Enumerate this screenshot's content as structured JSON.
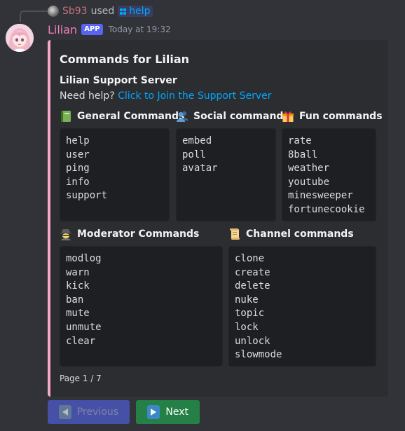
{
  "reply": {
    "username": "Sb93",
    "used_text": "used",
    "command": "help"
  },
  "message": {
    "author": "Lilian",
    "badge": "APP",
    "timestamp": "Today at 19:32"
  },
  "embed": {
    "accent_color": "#f7a8c8",
    "title": "Commands for Lilian",
    "subtitle": "Lilian Support Server",
    "help_prefix": "Need help?",
    "help_link": "Click to Join the Support Server",
    "fields": [
      {
        "icon": "green-book-icon",
        "name": "General Commands",
        "items": [
          "help",
          "user",
          "ping",
          "info",
          "support"
        ]
      },
      {
        "icon": "busts-in-silhouette-icon",
        "name": "Social commands",
        "items": [
          "embed",
          "poll",
          "avatar"
        ]
      },
      {
        "icon": "wrapped-gift-icon",
        "name": "Fun commands",
        "items": [
          "rate",
          "8ball",
          "weather",
          "youtube",
          "minesweeper",
          "fortunecookie"
        ]
      },
      {
        "icon": "detective-icon",
        "name": "Moderator Commands",
        "items": [
          "modlog",
          "warn",
          "kick",
          "ban",
          "mute",
          "unmute",
          "clear"
        ]
      },
      {
        "icon": "scroll-icon",
        "name": "Channel commands",
        "items": [
          "clone",
          "create",
          "delete",
          "nuke",
          "topic",
          "lock",
          "unlock",
          "slowmode"
        ]
      }
    ],
    "footer": "Page 1 / 7"
  },
  "buttons": {
    "previous": "Previous",
    "next": "Next"
  }
}
